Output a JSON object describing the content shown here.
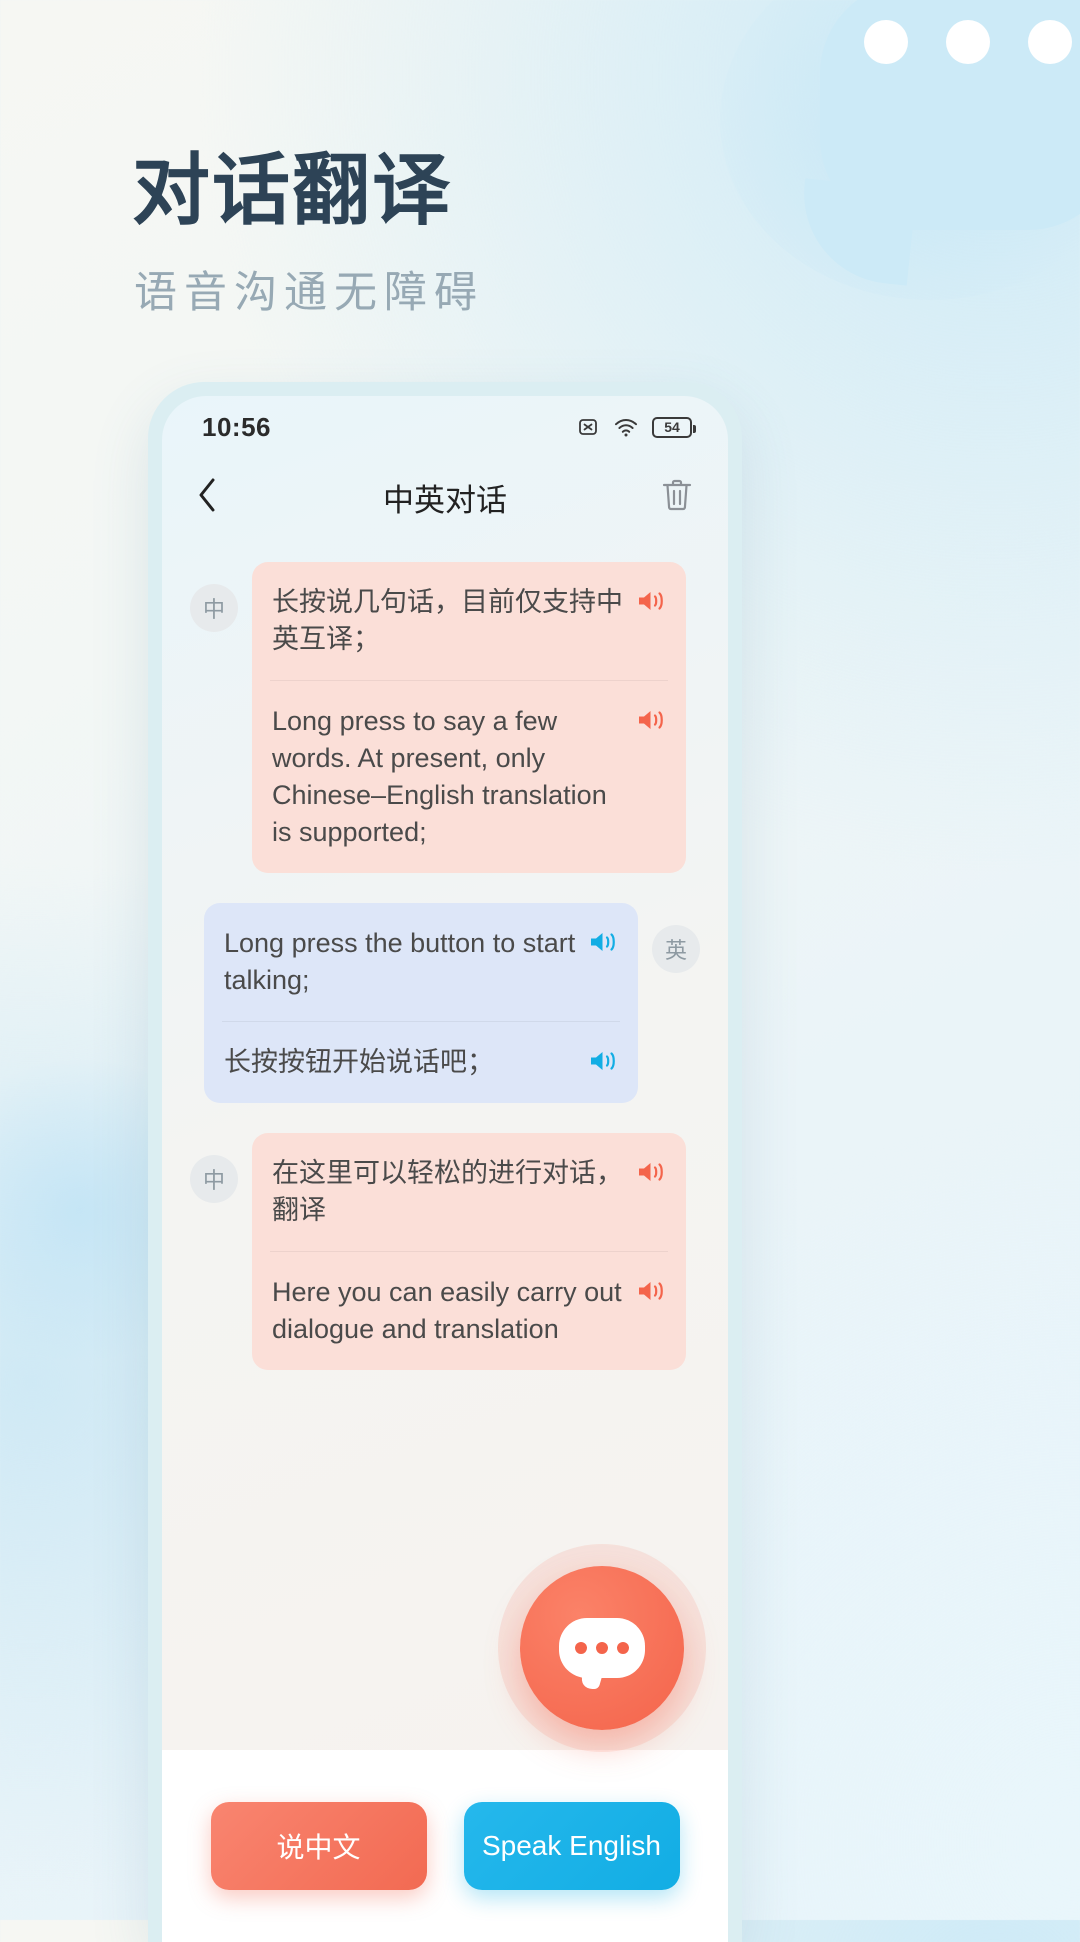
{
  "hero": {
    "title": "对话翻译",
    "subtitle": "语音沟通无障碍"
  },
  "colors": {
    "title": "#2d4356",
    "subtitle": "#97a9b4",
    "zh_bubble": "#fbdfd8",
    "en_bubble": "#dde6f8",
    "zh_speaker": "#f4644b",
    "en_speaker": "#12ade4",
    "accent_red": "#f26a52",
    "accent_blue": "#12ade4",
    "decor_blue": "#cceaf7"
  },
  "status_bar": {
    "time": "10:56",
    "icons": [
      "no-sim-icon",
      "wifi-icon",
      "battery-icon"
    ],
    "battery_level": "54"
  },
  "app_header": {
    "back_icon": "chevron-left-icon",
    "title": "中英对话",
    "delete_icon": "trash-icon"
  },
  "messages": [
    {
      "side": "left",
      "avatar": "中",
      "lang": "zh",
      "lines": [
        {
          "text": "长按说几句话，目前仅支持中英互译；",
          "speaker_icon": "speaker-icon"
        },
        {
          "text": "Long press to say a few words. At present, only Chinese–English translation is supported;",
          "speaker_icon": "speaker-icon"
        }
      ]
    },
    {
      "side": "right",
      "avatar": "英",
      "lang": "en",
      "lines": [
        {
          "text": "Long press the button to start talking;",
          "speaker_icon": "speaker-icon"
        },
        {
          "text": "长按按钮开始说话吧；",
          "speaker_icon": "speaker-icon"
        }
      ]
    },
    {
      "side": "left",
      "avatar": "中",
      "lang": "zh",
      "lines": [
        {
          "text": "在这里可以轻松的进行对话，翻译",
          "speaker_icon": "speaker-icon"
        },
        {
          "text": "Here you can easily carry out dialogue and translation",
          "speaker_icon": "speaker-icon"
        }
      ]
    }
  ],
  "fab": {
    "icon": "chat-bubble-dots-icon"
  },
  "bottom_bar": {
    "zh_button": "说中文",
    "en_button": "Speak English"
  }
}
